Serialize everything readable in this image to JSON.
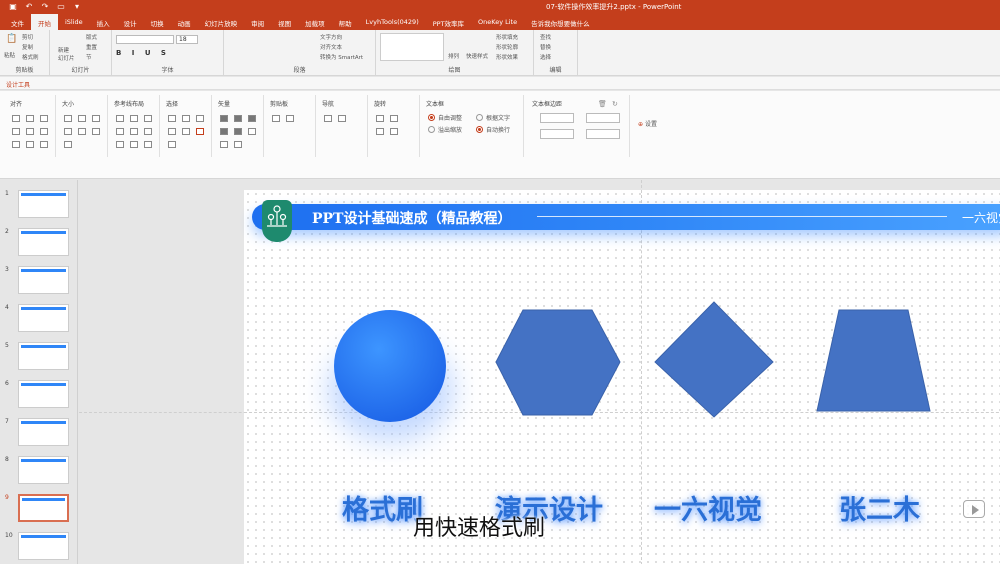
{
  "app": {
    "title": "07-软件操作效率提升2.pptx - PowerPoint"
  },
  "quick_access": [
    "save-icon",
    "undo-icon",
    "redo-icon",
    "start-from-beginning-icon",
    "customize-icon"
  ],
  "tabs": [
    {
      "label": "文件",
      "active": false
    },
    {
      "label": "开始",
      "active": true
    },
    {
      "label": "iSlide",
      "active": false
    },
    {
      "label": "插入",
      "active": false
    },
    {
      "label": "设计",
      "active": false
    },
    {
      "label": "切换",
      "active": false
    },
    {
      "label": "动画",
      "active": false
    },
    {
      "label": "幻灯片放映",
      "active": false
    },
    {
      "label": "审阅",
      "active": false
    },
    {
      "label": "视图",
      "active": false
    },
    {
      "label": "加载项",
      "active": false
    },
    {
      "label": "帮助",
      "active": false
    },
    {
      "label": "LvyhTools(0429)",
      "active": false
    },
    {
      "label": "PPT效率库",
      "active": false
    },
    {
      "label": "OneKey Lite",
      "active": false
    },
    {
      "label": "告诉我你想要做什么",
      "active": false
    }
  ],
  "ribbon": {
    "clipboard": {
      "label": "剪贴板",
      "paste": "粘贴",
      "cut": "剪切",
      "copy": "复制",
      "format_painter": "格式刷"
    },
    "slides": {
      "label": "幻灯片",
      "new_slide": "新建\n幻灯片",
      "layout": "版式",
      "reset": "重置",
      "section": "节"
    },
    "font": {
      "label": "字体",
      "size": "18"
    },
    "paragraph": {
      "label": "段落",
      "text_direction": "文字方向",
      "align_text": "对齐文本",
      "smartart": "转换为 SmartArt"
    },
    "drawing": {
      "label": "绘图",
      "arrange": "排列",
      "quick_styles": "快速样式",
      "fill": "形状填充",
      "outline": "形状轮廓",
      "effects": "形状效果"
    },
    "editing": {
      "label": "编辑",
      "find": "查找",
      "replace": "替换",
      "select": "选择"
    }
  },
  "context": {
    "label": "设计工具"
  },
  "design_panel": {
    "groups": [
      {
        "title": "对齐"
      },
      {
        "title": "大小"
      },
      {
        "title": "参考线布局"
      },
      {
        "title": "选择"
      },
      {
        "title": "矢量"
      },
      {
        "title": "剪贴板"
      },
      {
        "title": "导航"
      },
      {
        "title": "旋转"
      }
    ],
    "textbox": {
      "title": "文本框",
      "options": [
        {
          "label": "自由调整",
          "checked": true
        },
        {
          "label": "溢出缩放",
          "checked": false
        },
        {
          "label": "根据文字",
          "checked": false
        },
        {
          "label": "自动换行",
          "checked": true
        }
      ]
    },
    "margins": {
      "title": "文本框边距"
    },
    "settings_label": "设置"
  },
  "thumbnails": [
    {
      "number": "1",
      "selected": false
    },
    {
      "number": "2",
      "selected": false
    },
    {
      "number": "3",
      "selected": false
    },
    {
      "number": "4",
      "selected": false
    },
    {
      "number": "5",
      "selected": false
    },
    {
      "number": "6",
      "selected": false
    },
    {
      "number": "7",
      "selected": false
    },
    {
      "number": "8",
      "selected": false
    },
    {
      "number": "9",
      "selected": true
    },
    {
      "number": "10",
      "selected": false
    }
  ],
  "slide": {
    "banner_title": "PPT设计基础速成（精品教程）",
    "banner_right": "一六视觉",
    "shapes": [
      {
        "kind": "circle",
        "label": "格式刷",
        "color": "#2a7df5"
      },
      {
        "kind": "hexagon",
        "label": "演示设计",
        "color": "#4472c4"
      },
      {
        "kind": "diamond",
        "label": "一六视觉",
        "color": "#4472c4"
      },
      {
        "kind": "trapezoid",
        "label": "张二木",
        "color": "#4472c4"
      }
    ]
  },
  "subtitle": "用快速格式刷",
  "colors": {
    "accent": "#c43e1c",
    "banner": "#2f86f7",
    "shape": "#4472c4"
  }
}
